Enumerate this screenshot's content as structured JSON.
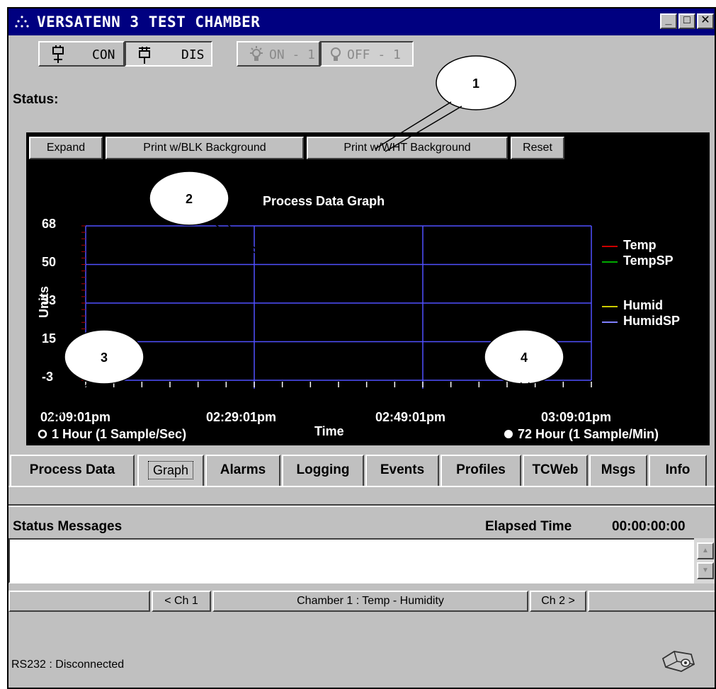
{
  "window": {
    "title": "VERSATENN 3 TEST CHAMBER",
    "min_glyph": "_",
    "max_glyph": "□",
    "close_glyph": "✕"
  },
  "toolbar": {
    "con_label": "CON",
    "dis_label": "DIS",
    "on_label": "ON - 1",
    "off_label": "OFF - 1"
  },
  "status": {
    "label": "Status:"
  },
  "graph": {
    "buttons": {
      "expand": "Expand",
      "print_blk": "Print w/BLK Background",
      "print_wht": "Print w/WHT Background",
      "reset": "Reset"
    },
    "radio_1hour": "1 Hour (1 Sample/Sec)",
    "radio_72hour": "72 Hour (1 Sample/Min)",
    "selected_range": "72 Hour (1 Sample/Min)"
  },
  "chart_data": {
    "type": "line",
    "title": "Process Data Graph",
    "xlabel": "Time",
    "ylabel": "Units",
    "y_ticks": [
      "68",
      "50",
      "33",
      "15",
      "-3"
    ],
    "x_ticks": [
      "02:09:01pm",
      "02:29:01pm",
      "02:49:01pm",
      "03:09:01pm"
    ],
    "ylim": [
      -3,
      68
    ],
    "grid": true,
    "legend_position": "right",
    "series": [
      {
        "name": "Temp",
        "values": [],
        "color": "#cc0000"
      },
      {
        "name": "TempSP",
        "values": [],
        "color": "#00aa00"
      },
      {
        "name": "Humid",
        "values": [],
        "color": "#cccc00"
      },
      {
        "name": "HumidSP",
        "values": [],
        "color": "#8080ff"
      }
    ],
    "grid_color": "#5050ff"
  },
  "callouts": [
    "1",
    "2",
    "3",
    "4"
  ],
  "tabs": [
    {
      "label": "Process Data"
    },
    {
      "label": "Graph"
    },
    {
      "label": "Alarms"
    },
    {
      "label": "Logging"
    },
    {
      "label": "Events"
    },
    {
      "label": "Profiles"
    },
    {
      "label": "TCWeb"
    },
    {
      "label": "Msgs"
    },
    {
      "label": "Info"
    }
  ],
  "active_tab": "Graph",
  "status_messages": {
    "heading": "Status Messages",
    "elapsed_label": "Elapsed Time",
    "elapsed_value": "00:00:00:00"
  },
  "channel_bar": {
    "prev": "< Ch 1",
    "current": "Chamber 1 : Temp - Humidity",
    "next": "Ch 2 >"
  },
  "footer": {
    "rs232": "RS232 : Disconnected"
  },
  "colors": {
    "title_bar": "#000080",
    "window_bg": "#c0c0c0",
    "graph_bg": "#000000"
  }
}
